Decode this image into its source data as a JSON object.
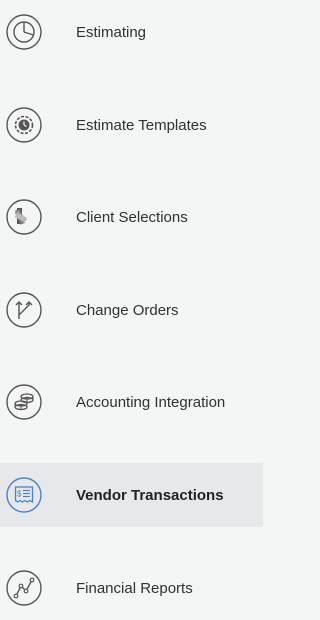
{
  "menu": {
    "items": [
      {
        "label": "Estimating",
        "icon": "pie-chart-icon",
        "active": false
      },
      {
        "label": "Estimate Templates",
        "icon": "gear-clock-icon",
        "active": false
      },
      {
        "label": "Client Selections",
        "icon": "swatches-icon",
        "active": false
      },
      {
        "label": "Change Orders",
        "icon": "arrows-up-icon",
        "active": false
      },
      {
        "label": "Accounting Integration",
        "icon": "coins-icon",
        "active": false
      },
      {
        "label": "Vendor Transactions",
        "icon": "receipt-icon",
        "active": true
      },
      {
        "label": "Financial Reports",
        "icon": "trend-line-icon",
        "active": false
      }
    ]
  },
  "colors": {
    "icon_stroke": "#555555",
    "active_icon": "#4a7fd6",
    "active_bg": "#e7e8e9",
    "background": "#f4f5f5"
  }
}
